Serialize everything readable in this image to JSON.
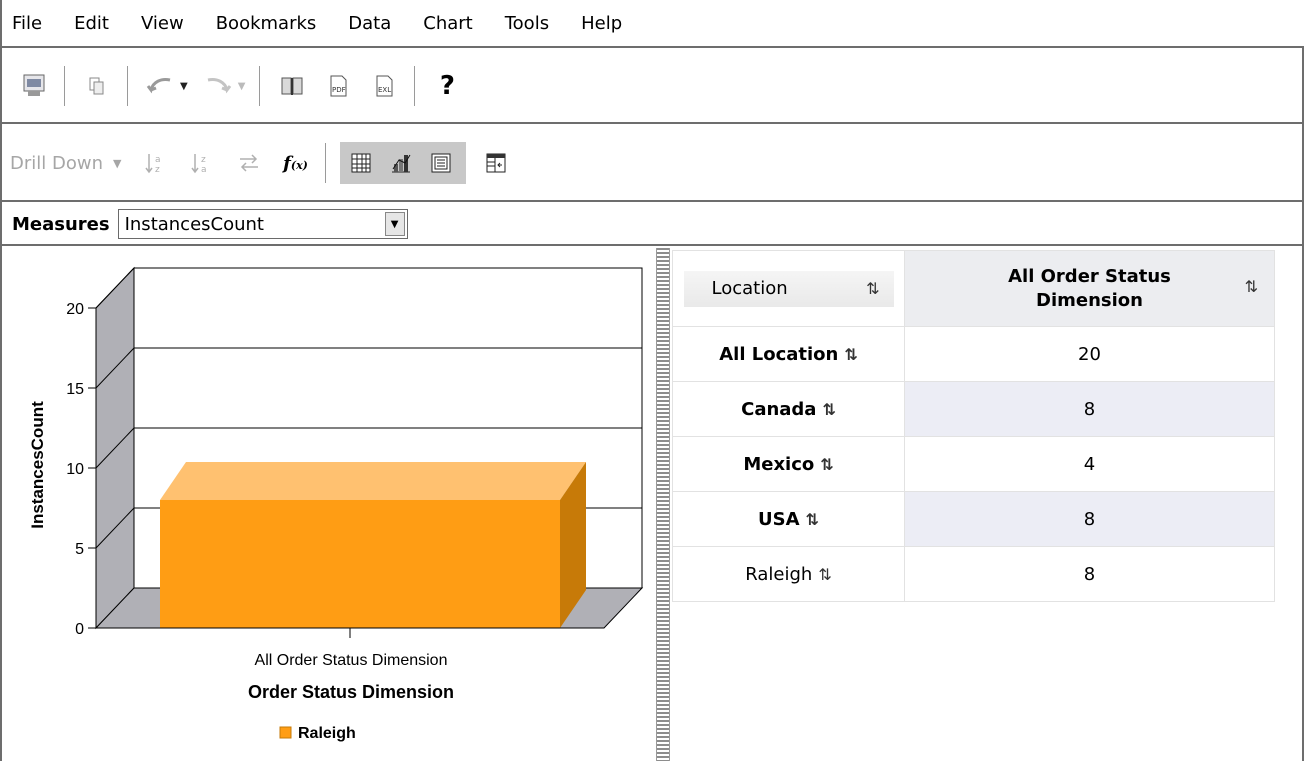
{
  "menu": [
    "File",
    "Edit",
    "View",
    "Bookmarks",
    "Data",
    "Chart",
    "Tools",
    "Help"
  ],
  "toolbar": {
    "help_glyph": "?"
  },
  "analysis_toolbar": {
    "drill_label": "Drill Down"
  },
  "measures": {
    "label": "Measures",
    "selected": "InstancesCount"
  },
  "chart_data": {
    "type": "bar",
    "style": "3d",
    "categories": [
      "All Order Status Dimension"
    ],
    "series": [
      {
        "name": "Raleigh",
        "values": [
          8
        ],
        "color": "#ff9d14"
      }
    ],
    "ylabel": "InstancesCount",
    "xlabel": "Order Status Dimension",
    "ylim": [
      0,
      20
    ],
    "yticks": [
      "20",
      "15",
      "10",
      "5",
      "0"
    ],
    "legend_position": "bottom"
  },
  "grid": {
    "row_header": "Location",
    "col_header_line1": "All Order Status",
    "col_header_line2": "Dimension",
    "sort_glyph": "⇅",
    "rows": [
      {
        "label": "All Location",
        "value": "20"
      },
      {
        "label": "Canada",
        "value": "8"
      },
      {
        "label": "Mexico",
        "value": "4"
      },
      {
        "label": "USA",
        "value": "8"
      },
      {
        "label": "Raleigh",
        "value": "8"
      }
    ]
  }
}
